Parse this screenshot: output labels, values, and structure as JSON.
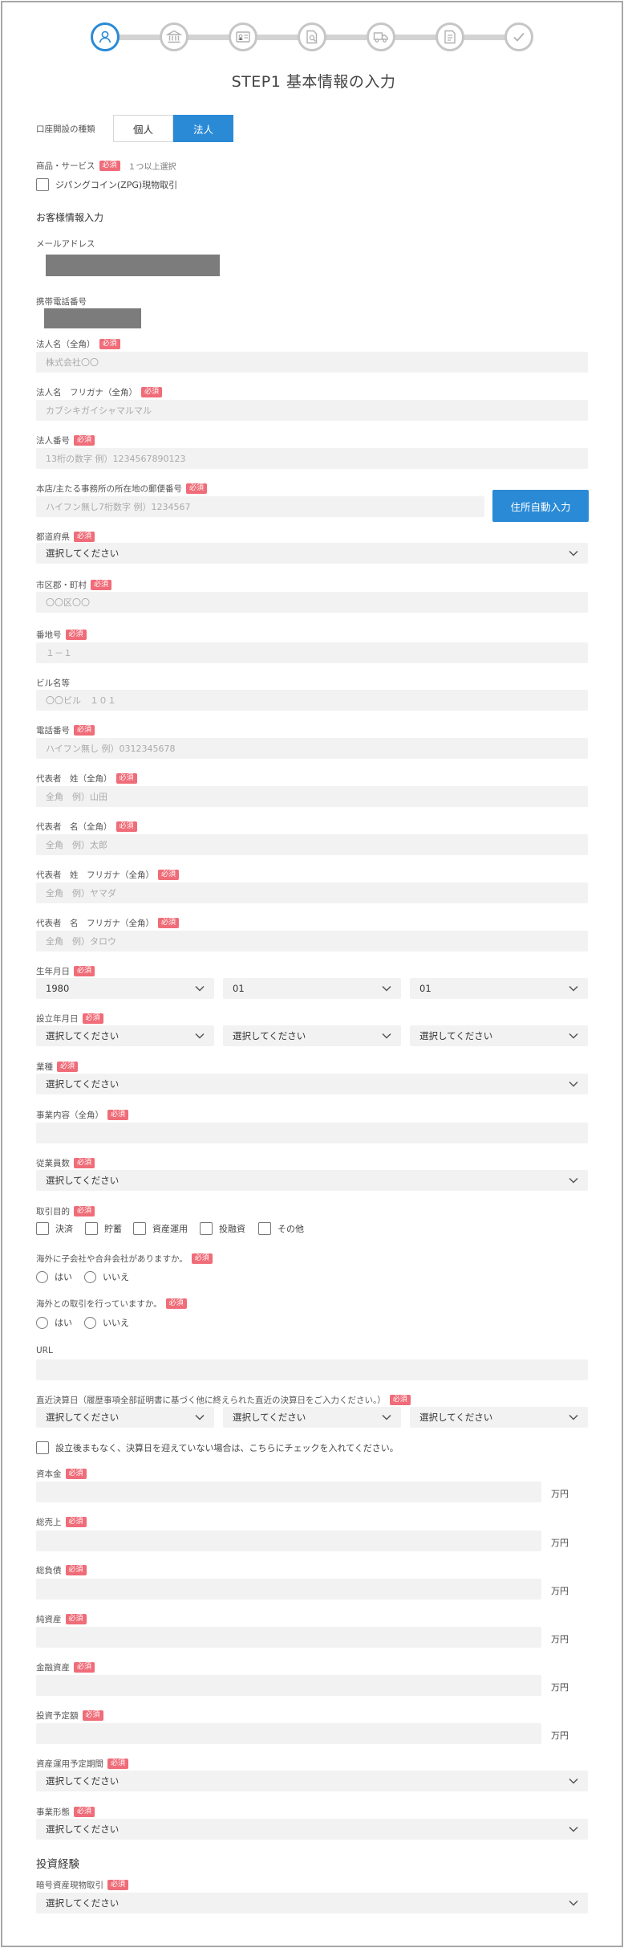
{
  "title": "STEP1 基本情報の入力",
  "steps": [
    {
      "icon": "user-icon"
    },
    {
      "icon": "bank-icon"
    },
    {
      "icon": "id-card-icon"
    },
    {
      "icon": "document-search-icon"
    },
    {
      "icon": "truck-icon"
    },
    {
      "icon": "document-icon"
    },
    {
      "icon": "check-icon"
    }
  ],
  "colors": {
    "accent": "#2a8ad6",
    "required": "#ef6c78",
    "field_bg": "#f2f2f2"
  },
  "account_type": {
    "label": "口座開設の種類",
    "options": [
      "個人",
      "法人"
    ],
    "selected": "法人"
  },
  "products": {
    "label": "商品・サービス",
    "req": "必須",
    "note": "１つ以上選択",
    "option": "ジパングコイン(ZPG)現物取引"
  },
  "customer_section": "お客様情報入力",
  "email": {
    "label": "メールアドレス"
  },
  "phone": {
    "label": "携帯電話番号"
  },
  "corp_name": {
    "label": "法人名（全角）",
    "req": "必須",
    "placeholder": "株式会社〇〇"
  },
  "corp_kana": {
    "label": "法人名　フリガナ（全角）",
    "req": "必須",
    "placeholder": "カブシキガイシャマルマル"
  },
  "corp_number": {
    "label": "法人番号",
    "req": "必須",
    "placeholder": "13桁の数字 例）1234567890123"
  },
  "postal": {
    "label": "本店/主たる事務所の所在地の郵便番号",
    "req": "必須",
    "placeholder": "ハイフン無し7桁数字 例）1234567",
    "button": "住所自動入力"
  },
  "prefecture": {
    "label": "都道府県",
    "req": "必須",
    "value": "選択してください"
  },
  "city": {
    "label": "市区郡・町村",
    "req": "必須",
    "placeholder": "〇〇区〇〇"
  },
  "block": {
    "label": "番地号",
    "req": "必須",
    "placeholder": "１－１"
  },
  "building": {
    "label": "ビル名等",
    "placeholder": "〇〇ビル　１０１"
  },
  "tel": {
    "label": "電話番号",
    "req": "必須",
    "placeholder": "ハイフン無し 例）0312345678"
  },
  "rep_last": {
    "label": "代表者　姓（全角）",
    "req": "必須",
    "placeholder": "全角　例）山田"
  },
  "rep_first": {
    "label": "代表者　名（全角）",
    "req": "必須",
    "placeholder": "全角　例）太郎"
  },
  "rep_last_kana": {
    "label": "代表者　姓　フリガナ（全角）",
    "req": "必須",
    "placeholder": "全角　例）ヤマダ"
  },
  "rep_first_kana": {
    "label": "代表者　名　フリガナ（全角）",
    "req": "必須",
    "placeholder": "全角　例）タロウ"
  },
  "birth": {
    "label": "生年月日",
    "req": "必須",
    "year": "1980",
    "month": "01",
    "day": "01"
  },
  "founded": {
    "label": "設立年月日",
    "req": "必須",
    "year": "選択してください",
    "month": "選択してください",
    "day": "選択してください"
  },
  "industry": {
    "label": "業種",
    "req": "必須",
    "value": "選択してください"
  },
  "business": {
    "label": "事業内容（全角）",
    "req": "必須"
  },
  "employees": {
    "label": "従業員数",
    "req": "必須",
    "value": "選択してください"
  },
  "purpose": {
    "label": "取引目的",
    "req": "必須",
    "options": [
      "決済",
      "貯蓄",
      "資産運用",
      "投融資",
      "その他"
    ]
  },
  "overseas_sub": {
    "label": "海外に子会社や合弁会社がありますか。",
    "req": "必須",
    "options": [
      "はい",
      "いいえ"
    ]
  },
  "overseas_trade": {
    "label": "海外との取引を行っていますか。",
    "req": "必須",
    "options": [
      "はい",
      "いいえ"
    ]
  },
  "url": {
    "label": "URL"
  },
  "fiscal": {
    "label": "直近決算日（履歴事項全部証明書に基づく他に終えられた直近の決算日をご入力ください。）",
    "req": "必須",
    "year": "選択してください",
    "month": "選択してください",
    "day": "選択してください"
  },
  "no_fiscal": {
    "label": "設立後まもなく、決算日を迎えていない場合は、こちらにチェックを入れてください。"
  },
  "unit": "万円",
  "capital": {
    "label": "資本金",
    "req": "必須"
  },
  "sales": {
    "label": "総売上",
    "req": "必須"
  },
  "liabilities": {
    "label": "総負債",
    "req": "必須"
  },
  "net_assets": {
    "label": "純資産",
    "req": "必須"
  },
  "financial_assets": {
    "label": "金融資産",
    "req": "必須"
  },
  "investment_plan": {
    "label": "投資予定額",
    "req": "必須"
  },
  "asset_period": {
    "label": "資産運用予定期間",
    "req": "必須",
    "value": "選択してください"
  },
  "business_form": {
    "label": "事業形態",
    "req": "必須",
    "value": "選択してください"
  },
  "experience_section": "投資経験",
  "crypto": {
    "label": "暗号資産現物取引",
    "req": "必須",
    "value": "選択してください"
  }
}
